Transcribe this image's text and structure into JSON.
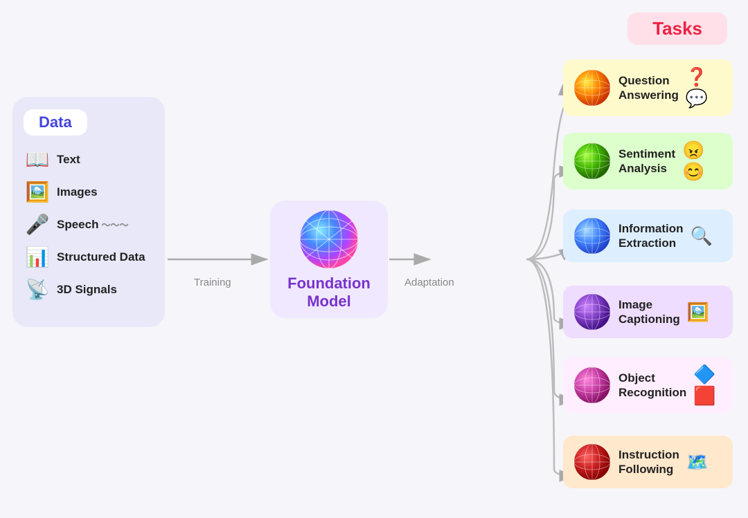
{
  "data_panel": {
    "title": "Data",
    "items": [
      {
        "id": "text",
        "label": "Text",
        "emoji": "📖"
      },
      {
        "id": "images",
        "label": "Images",
        "emoji": "🖼️"
      },
      {
        "id": "speech",
        "label": "Speech",
        "emoji": "🎤"
      },
      {
        "id": "structured",
        "label": "Structured Data",
        "emoji": "📊"
      },
      {
        "id": "signals",
        "label": "3D Signals",
        "emoji": "📡"
      }
    ]
  },
  "labels": {
    "training": "Training",
    "adaptation": "Adaptation",
    "foundation_model": "Foundation\nModel"
  },
  "tasks_title": "Tasks",
  "tasks": [
    {
      "id": "qa",
      "label": "Question\nAnswering",
      "emoji": "❓💬",
      "bg": "#fffacc"
    },
    {
      "id": "sa",
      "label": "Sentiment\nAnalysis",
      "emoji": "😊😠",
      "bg": "#ddffcc"
    },
    {
      "id": "ie",
      "label": "Information\nExtraction",
      "emoji": "🔍",
      "bg": "#ddeeff"
    },
    {
      "id": "ic",
      "label": "Image\nCaptioning",
      "emoji": "🖼️",
      "bg": "#eeddff"
    },
    {
      "id": "or",
      "label": "Object\nRecognition",
      "emoji": "🔷🟥",
      "bg": "#ffeeff"
    },
    {
      "id": "if",
      "label": "Instruction\nFollowing",
      "emoji": "🗺️",
      "bg": "#ffe8cc"
    }
  ]
}
